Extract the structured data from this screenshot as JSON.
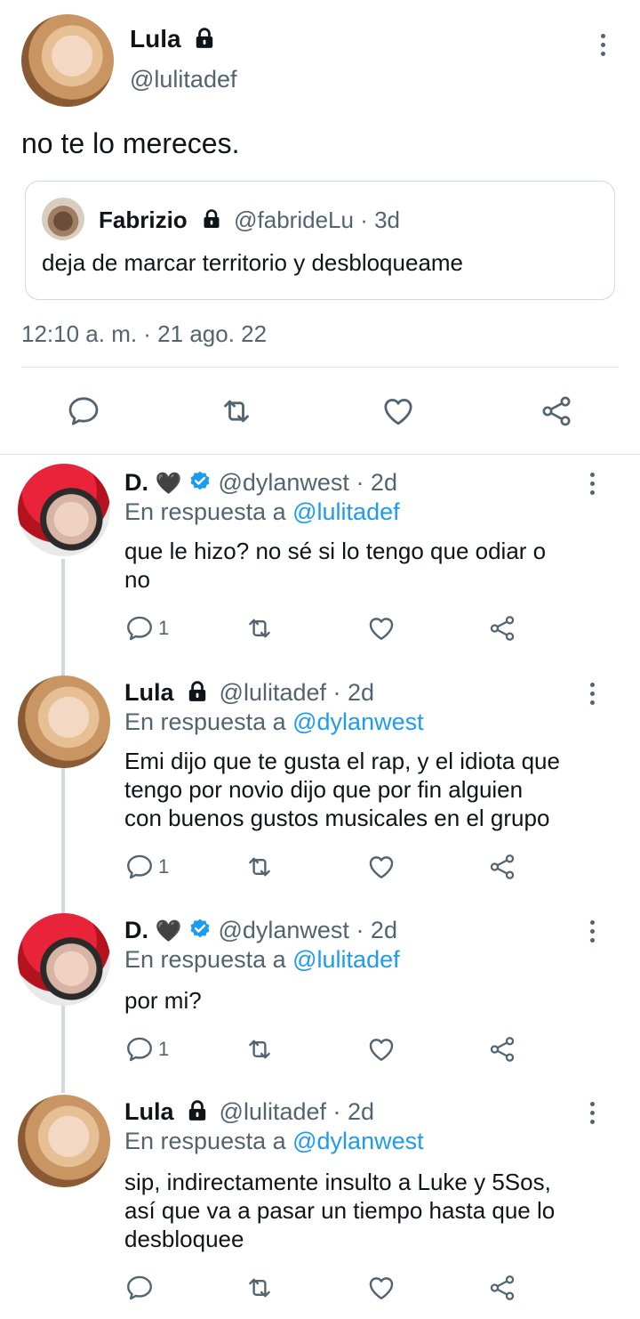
{
  "main_tweet": {
    "name": "Lula",
    "handle": "@lulitadef",
    "text": "no te lo mereces.",
    "timestamp": "12:10 a. m. · 21 ago. 22",
    "quoted": {
      "name": "Fabrizio",
      "handle": "@fabrideLu",
      "time": "· 3d",
      "text": "deja de marcar territorio y desbloqueame"
    }
  },
  "replies": [
    {
      "name": "D.",
      "heart": "🖤",
      "handle": "@dylanwest",
      "time": "· 2d",
      "reply_prefix": "En respuesta a ",
      "reply_to": "@lulitadef",
      "text_lines": [
        "que le hizo? no sé si lo tengo que odiar o",
        "no"
      ],
      "reply_count": "1"
    },
    {
      "name": "Lula",
      "handle": "@lulitadef",
      "time": "· 2d",
      "reply_prefix": "En respuesta a ",
      "reply_to": "@dylanwest",
      "text_lines": [
        "Emi dijo que te gusta el rap, y el idiota que",
        "tengo por novio dijo que por fin alguien",
        "con buenos gustos musicales en el grupo"
      ],
      "reply_count": "1"
    },
    {
      "name": "D.",
      "heart": "🖤",
      "handle": "@dylanwest",
      "time": "· 2d",
      "reply_prefix": "En respuesta a ",
      "reply_to": "@lulitadef",
      "text_lines": [
        "por mi?"
      ],
      "reply_count": "1"
    },
    {
      "name": "Lula",
      "handle": "@lulitadef",
      "time": "· 2d",
      "reply_prefix": "En respuesta a ",
      "reply_to": "@dylanwest",
      "text_lines": [
        "sip, indirectamente insulto a Luke y 5Sos,",
        "así que va a pasar un tiempo hasta que lo",
        "desbloquee"
      ],
      "reply_count": ""
    }
  ],
  "icons": {
    "reply": "reply-icon",
    "retweet": "retweet-icon",
    "like": "like-icon",
    "share": "share-icon",
    "lock": "lock-icon",
    "verified": "verified-badge-icon",
    "more": "more-options-icon"
  },
  "colors": {
    "text": "#0f1419",
    "secondary": "#536471",
    "accent": "#1d9bf0",
    "border": "#cfd9de"
  }
}
